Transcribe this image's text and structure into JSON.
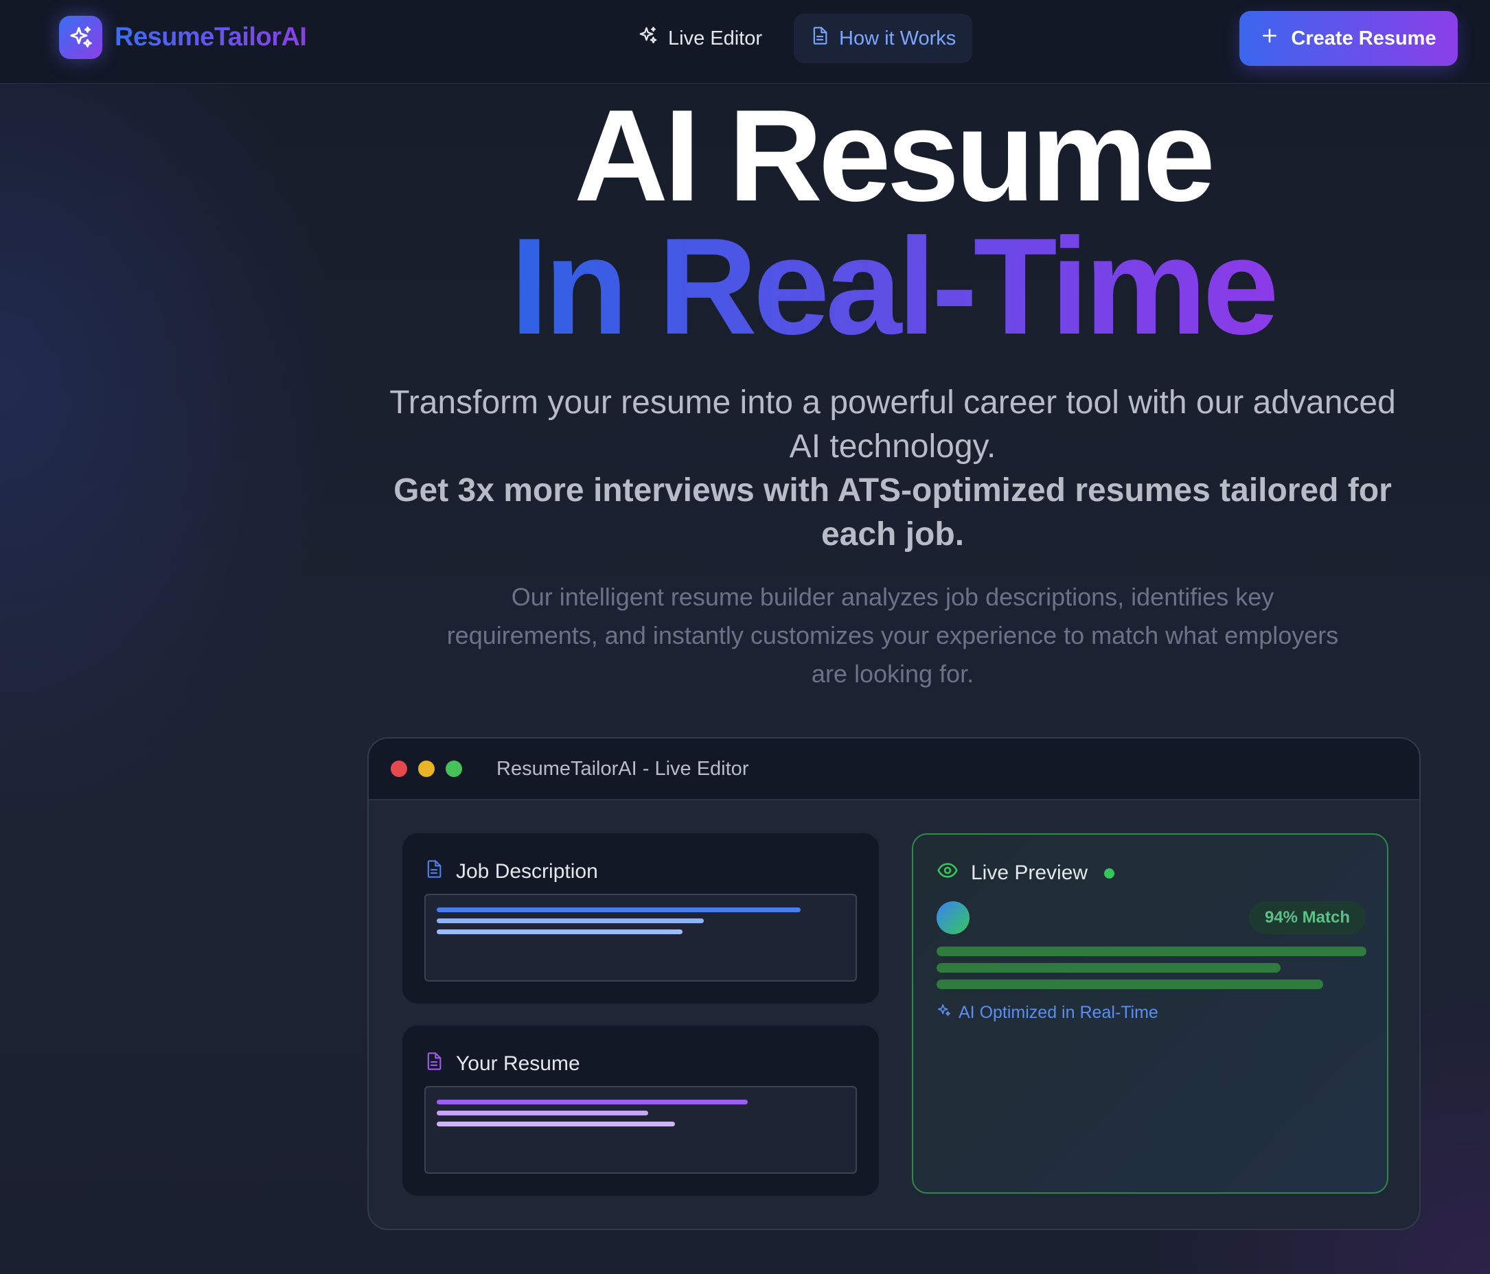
{
  "nav": {
    "brand_name": "ResumeTailorAI",
    "links": [
      {
        "label": "Live Editor",
        "icon": "sparkles-icon",
        "active": false
      },
      {
        "label": "How it Works",
        "icon": "document-icon",
        "active": true
      }
    ],
    "cta_label": "Create Resume"
  },
  "hero": {
    "title_line1": "AI Resume",
    "title_line2": "In Real-Time",
    "lead": "Transform your resume into a powerful career tool with our advanced AI technology.",
    "lead_strong": "Get 3x more interviews with ATS-optimized resumes tailored for each job.",
    "description": "Our intelligent resume builder analyzes job descriptions, identifies key requirements, and instantly customizes your experience to match what employers are looking for."
  },
  "editor": {
    "window_title": "ResumeTailorAI - Live Editor",
    "job_panel_title": "Job Description",
    "resume_panel_title": "Your Resume",
    "preview_title": "Live Preview",
    "match_badge": "94% Match",
    "ai_label": "AI Optimized in Real-Time"
  },
  "colors": {
    "accent_blue": "#3b6ef0",
    "accent_purple": "#8b3fe8",
    "success_green": "#34c759",
    "window_red": "#e5484d",
    "window_yellow": "#e8b425",
    "window_green": "#45c15a"
  }
}
